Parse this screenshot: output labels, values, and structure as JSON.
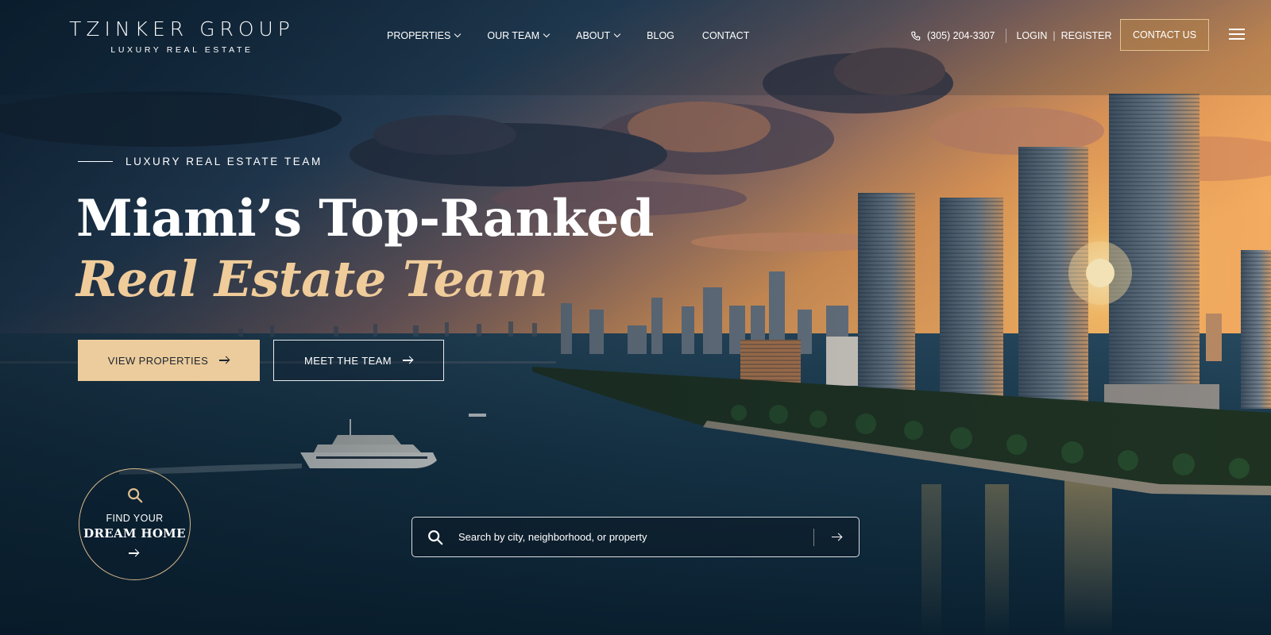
{
  "brand": {
    "name": "TZINKER GROUP",
    "tagline": "LUXURY REAL ESTATE"
  },
  "nav": [
    {
      "label": "PROPERTIES",
      "dropdown": true
    },
    {
      "label": "OUR TEAM",
      "dropdown": true
    },
    {
      "label": "ABOUT",
      "dropdown": true
    },
    {
      "label": "BLOG",
      "dropdown": false
    },
    {
      "label": "CONTACT",
      "dropdown": false
    }
  ],
  "utility": {
    "phone": "(305) 204-3307",
    "login": "LOGIN",
    "separator": "|",
    "register": "REGISTER",
    "contact_button": "CONTACT US",
    "menu_icon": "hamburger-menu-icon",
    "phone_icon": "phone-icon"
  },
  "hero": {
    "eyebrow": "LUXURY REAL ESTATE TEAM",
    "headline_line1": "Miami’s Top-Ranked",
    "headline_line2": "Real Estate Team",
    "primary_button": "VIEW PROPERTIES",
    "secondary_button": "MEET THE TEAM"
  },
  "find_home": {
    "line1": "FIND YOUR",
    "line2": "DREAM HOME"
  },
  "search": {
    "placeholder": "Search by city, neighborhood, or property"
  },
  "colors": {
    "accent_gold": "#eccc9c",
    "headline_gold": "#efcc9a",
    "contact_border": "#e3c291",
    "text": "#ffffff"
  }
}
